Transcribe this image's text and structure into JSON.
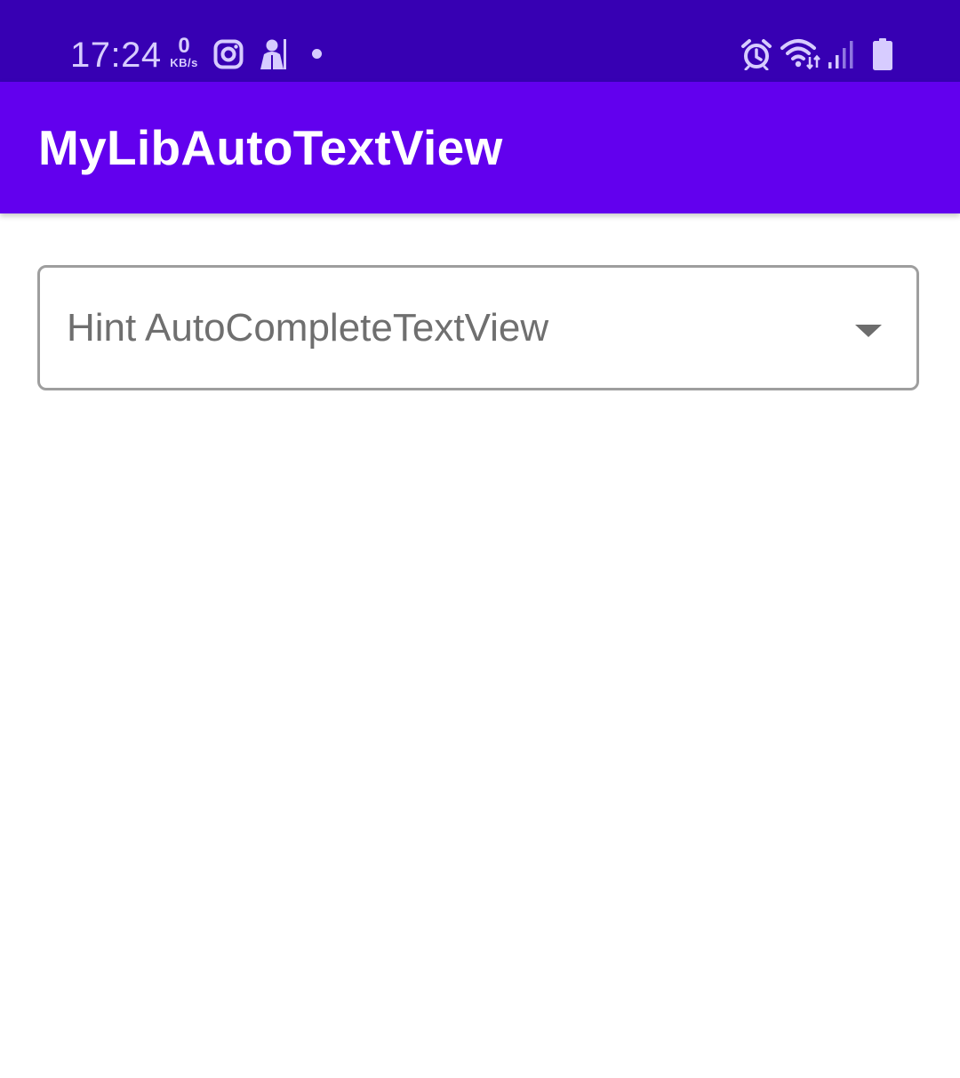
{
  "status_bar": {
    "time": "17:24",
    "net_speed_value": "0",
    "net_speed_unit": "KB/s",
    "icons": [
      "instagram-icon",
      "notification-app-icon",
      "notification-dot",
      "alarm-icon",
      "wifi-icon",
      "cellular-signal-icon",
      "battery-icon"
    ]
  },
  "app_bar": {
    "title": "MyLibAutoTextView"
  },
  "autocomplete": {
    "placeholder": "Hint AutoCompleteTextView",
    "value": "",
    "trailing_icon": "dropdown-arrow-icon"
  },
  "colors": {
    "status_bar": "#3700b3",
    "app_bar": "#6200ee",
    "field_border": "#9e9e9e",
    "hint_text": "#6f6f6f"
  }
}
